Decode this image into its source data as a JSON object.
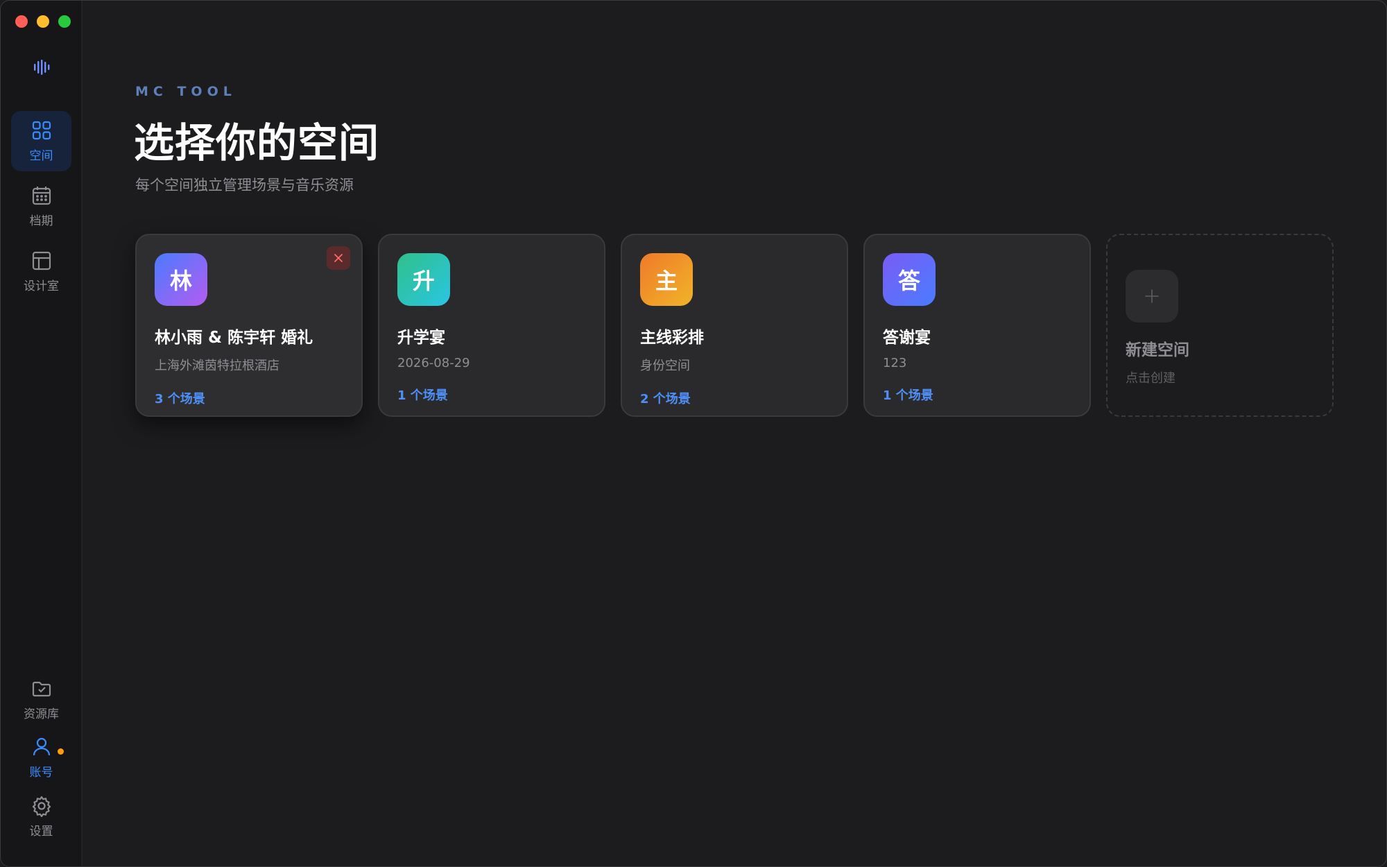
{
  "sidebar": {
    "nav": [
      {
        "label": "空间",
        "icon": "grid-icon"
      },
      {
        "label": "档期",
        "icon": "calendar-icon"
      },
      {
        "label": "设计室",
        "icon": "layout-icon"
      }
    ],
    "bottom": [
      {
        "label": "资源库",
        "icon": "folder-check-icon"
      },
      {
        "label": "账号",
        "icon": "user-icon"
      },
      {
        "label": "设置",
        "icon": "gear-icon"
      }
    ]
  },
  "header": {
    "eyebrow": "MC TOOL",
    "title": "选择你的空间",
    "subtitle": "每个空间独立管理场景与音乐资源"
  },
  "spaces": [
    {
      "avatar": "林",
      "title": "林小雨 & 陈宇轩 婚礼",
      "subtitle": "上海外滩茵特拉根酒店",
      "scenes": "3 个场景"
    },
    {
      "avatar": "升",
      "title": "升学宴",
      "subtitle": "2026-08-29",
      "scenes": "1 个场景"
    },
    {
      "avatar": "主",
      "title": "主线彩排",
      "subtitle": "身份空间",
      "scenes": "2 个场景"
    },
    {
      "avatar": "答",
      "title": "答谢宴",
      "subtitle": "123",
      "scenes": "1 个场景"
    }
  ],
  "new_space": {
    "title": "新建空间",
    "subtitle": "点击创建"
  },
  "colors": {
    "accent": "#3b8cff",
    "link": "#4f8ff7",
    "badge": "#ff9f0a",
    "delete": "#ff6b6b"
  }
}
